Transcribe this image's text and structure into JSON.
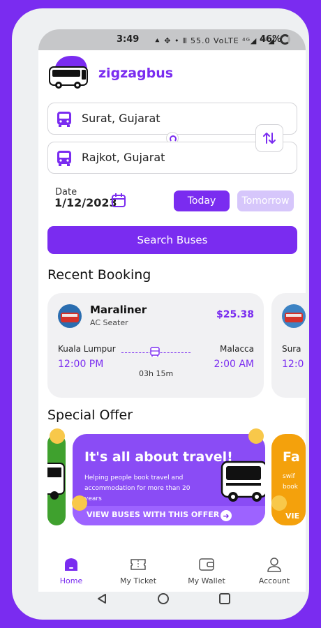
{
  "status_bar": {
    "time": "3:49",
    "icons": "⯅ ✥ • 𝍫 55.0 VoLTE ⁴ᴳ◢ ⁵ᴳ◢",
    "battery": "46%"
  },
  "app": {
    "name": "zigzagbus"
  },
  "search": {
    "from": "Surat, Gujarat",
    "to": "Rajkot, Gujarat",
    "date_label": "Date",
    "date_value": "1/12/2023",
    "today_label": "Today",
    "tomorrow_label": "Tomorrow",
    "search_label": "Search Buses"
  },
  "recent": {
    "title": "Recent Booking",
    "bookings": [
      {
        "operator": "Maraliner",
        "seat_type": "AC Seater",
        "price": "$25.38",
        "from": "Kuala Lumpur",
        "to": "Malacca",
        "departure": "12:00 PM",
        "arrival": "2:00 AM",
        "duration": "03h 15m"
      },
      {
        "from": "Sura",
        "departure": "12:0"
      }
    ]
  },
  "offers": {
    "title": "Special Offer",
    "items": [
      {
        "title": "It's all about travel!",
        "description": "Helping people book travel and accommodation for more than 20 years",
        "cta": "VIEW BUSES WITH THIS OFFER"
      },
      {
        "title": "Fa",
        "desc_line1": "swif",
        "desc_line2": "book",
        "cta": "VIE"
      }
    ]
  },
  "nav": {
    "home": "Home",
    "ticket": "My Ticket",
    "wallet": "My Wallet",
    "account": "Account"
  },
  "colors": {
    "accent": "#7a2cf0",
    "accent_light": "#d6c6fb",
    "card_bg": "#f1f1f3"
  }
}
